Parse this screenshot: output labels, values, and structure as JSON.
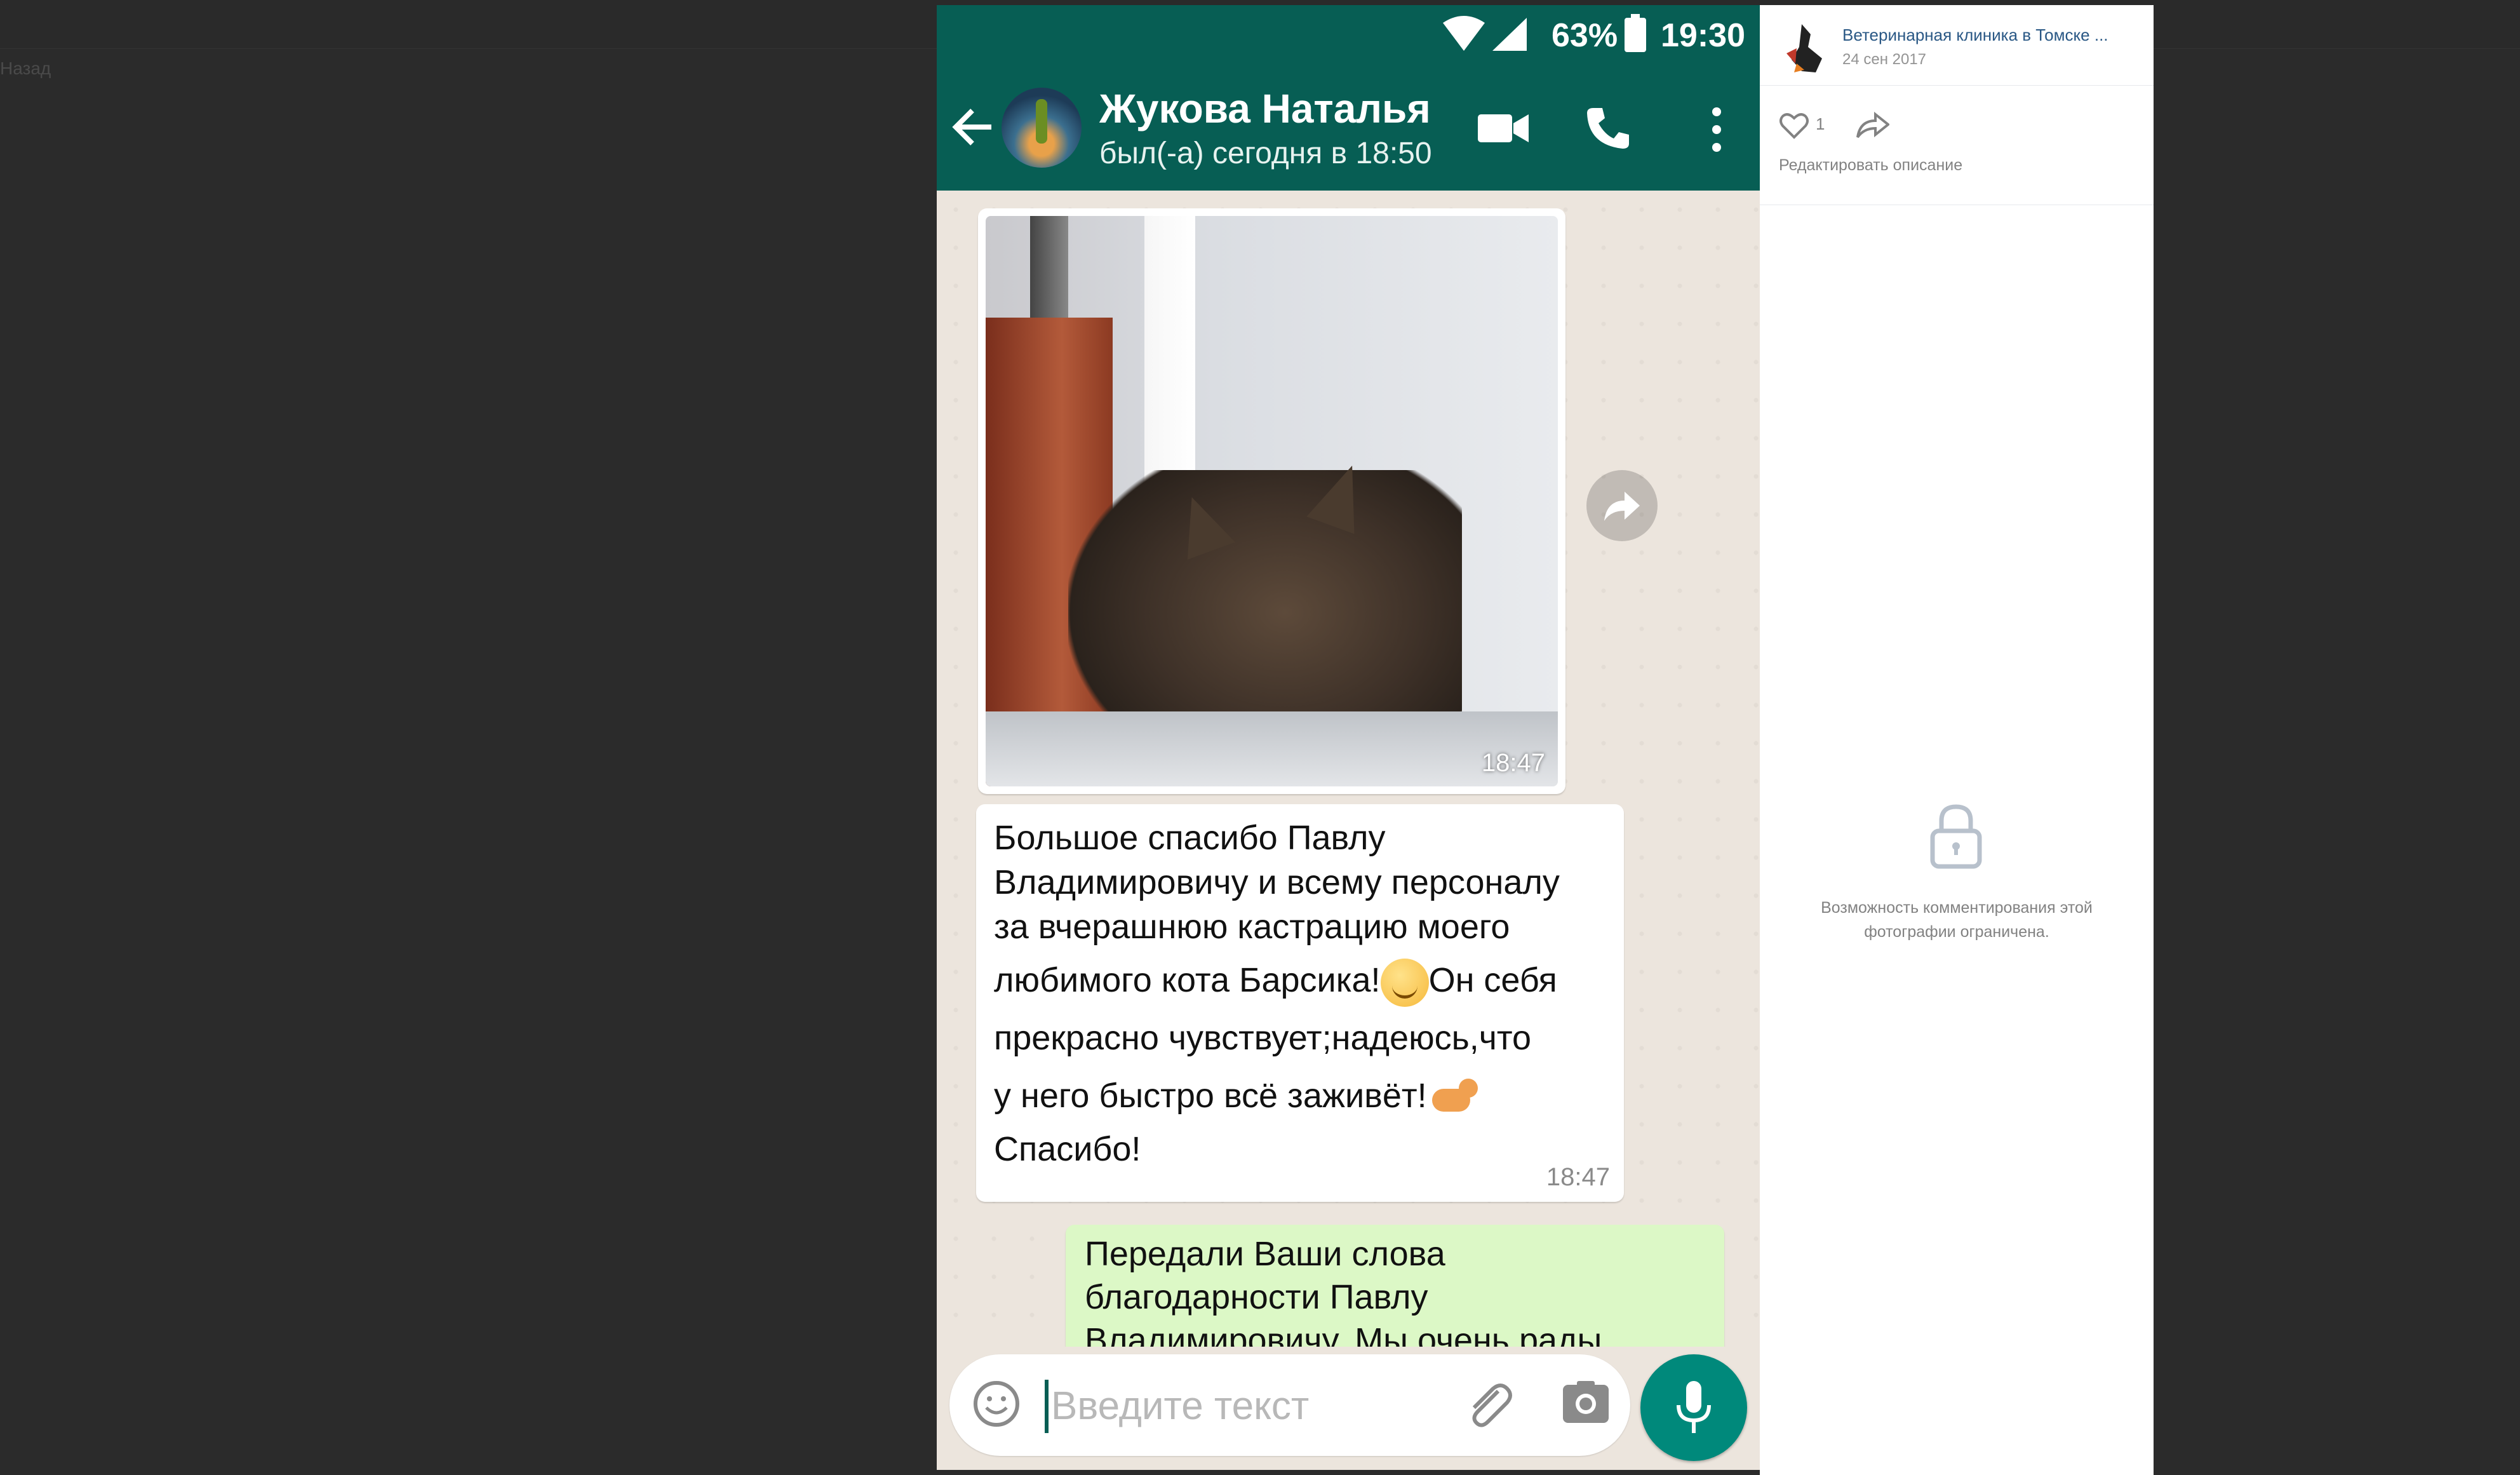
{
  "background": {
    "back_link": "Назад"
  },
  "status_bar": {
    "battery": "63%",
    "time": "19:30"
  },
  "chat_header": {
    "contact_name": "Жукова Наталья",
    "last_seen": "был(-а) сегодня в 18:50"
  },
  "messages": {
    "image": {
      "time": "18:47"
    },
    "incoming": {
      "lines": [
        "Большое спасибо Павлу",
        "Владимировичу и всему персоналу",
        "за вчерашнюю кастрацию моего",
        "любимого кота Барсика!",
        "Он себя",
        "прекрасно чувствует;надеюсь,что",
        "у него быстро всё заживёт!",
        "Спасибо!"
      ],
      "time": "18:47"
    },
    "outgoing": {
      "lines": [
        "Передали Ваши слова",
        "благодарности Павлу",
        "Владимировичу. Мы очень рады"
      ]
    }
  },
  "input": {
    "placeholder": "Введите текст"
  },
  "post_panel": {
    "group_name": "Ветеринарная клиника в Томске ...",
    "date": "24 сен 2017",
    "like_count": "1",
    "edit_description": "Редактировать описание",
    "comments_restricted": "Возможность комментирования этой фотографии ограничена."
  },
  "colors": {
    "header_green": "#075e54",
    "outgoing_bubble": "#dcf8c6",
    "mic_button": "#00897b",
    "vk_link": "#2a5885"
  }
}
